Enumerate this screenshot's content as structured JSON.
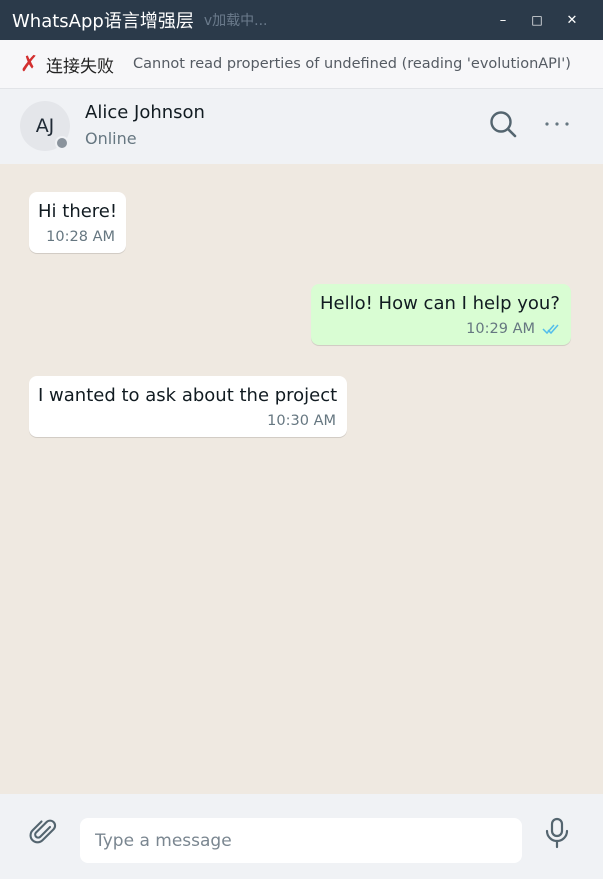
{
  "window": {
    "title": "WhatsApp语言增强层",
    "version_text": "v加载中...",
    "controls": {
      "minimize": "–",
      "maximize": "□",
      "close": "✕"
    }
  },
  "error_banner": {
    "icon": "✗",
    "title": "连接失败",
    "message": "Cannot read properties of undefined (reading 'evolutionAPI')"
  },
  "chat_header": {
    "avatar_initials": "AJ",
    "contact_name": "Alice Johnson",
    "status": "Online",
    "icons": [
      "search-icon",
      "more-options-icon"
    ]
  },
  "messages": [
    {
      "direction": "incoming",
      "text": "Hi there!",
      "time": "10:28 AM"
    },
    {
      "direction": "outgoing",
      "text": "Hello! How can I help you?",
      "time": "10:29 AM",
      "status_icon": "double-check-icon"
    },
    {
      "direction": "incoming",
      "text": "I wanted to ask about the project",
      "time": "10:30 AM"
    }
  ],
  "composer": {
    "placeholder": "Type a message",
    "value": "",
    "icons": [
      "paperclip-icon",
      "microphone-icon"
    ]
  },
  "colors": {
    "titlebar": "#2b3a4a",
    "chat_background": "#efe9e1",
    "incoming_bubble": "#ffffff",
    "outgoing_bubble": "#d9fdd3",
    "error_icon": "#d32f2f",
    "read_ticks": "#53bdeb"
  }
}
